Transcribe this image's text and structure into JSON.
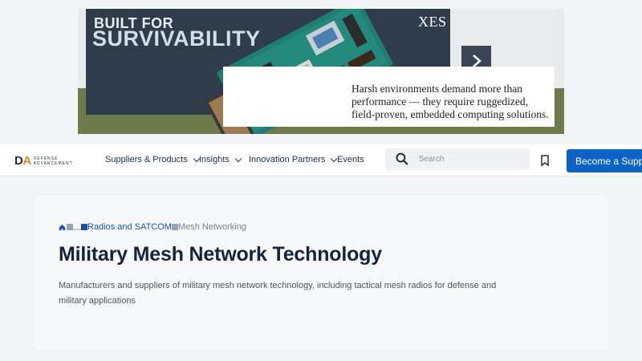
{
  "ad": {
    "headline_small": "BUILT FOR",
    "headline_big": "SURVIVABILITY",
    "brand": "XES",
    "body": "Harsh environments demand more than performance — they require ruggedized, field-proven, embedded computing solutions."
  },
  "nav": {
    "logo_letters": "DA",
    "logo_line1": "DEFENSE",
    "logo_line2": "ADVANCEMENT",
    "items": [
      {
        "label": "Suppliers & Products"
      },
      {
        "label": "Insights"
      },
      {
        "label": "Innovation Partners"
      },
      {
        "label": "Events"
      }
    ],
    "search_placeholder": "Search",
    "cta_label": "Become a Supplier"
  },
  "breadcrumb": {
    "parent": "Radios and SATCOM",
    "current": "Mesh Networking"
  },
  "page": {
    "title": "Military Mesh Network Technology",
    "description": "Manufacturers and suppliers of military mesh network technology, including tactical mesh radios for defense and military applications"
  },
  "colors": {
    "primary": "#0b63c5",
    "heading": "#13243f",
    "ad_dark": "#2f3c4b",
    "ad_green": "#6d7b4a"
  }
}
